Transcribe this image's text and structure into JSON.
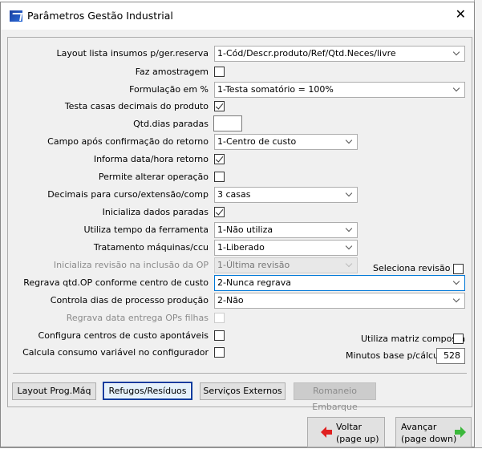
{
  "window": {
    "title": "Parâmetros Gestão Industrial"
  },
  "fields": [
    {
      "name": "layout-lista-insumos",
      "label": "Layout lista insumos p/ger.reserva",
      "type": "combo",
      "value": "1-Cód/Descr.produto/Ref/Qtd.Neces/livre",
      "wide": true
    },
    {
      "name": "faz-amostragem",
      "label": "Faz amostragem",
      "type": "check",
      "checked": false
    },
    {
      "name": "formulacao",
      "label": "Formulação em %",
      "type": "combo",
      "value": "1-Testa somatório = 100%",
      "wide": true
    },
    {
      "name": "testa-casas-decimais",
      "label": "Testa casas decimais do produto",
      "type": "check",
      "checked": true
    },
    {
      "name": "qtd-dias-paradas",
      "label": "Qtd.dias paradas",
      "type": "text",
      "value": ""
    },
    {
      "name": "campo-apos-confirmacao",
      "label": "Campo após confirmação do retorno",
      "type": "combo",
      "value": "1-Centro de custo"
    },
    {
      "name": "informa-data-hora",
      "label": "Informa data/hora retorno",
      "type": "check",
      "checked": true
    },
    {
      "name": "permite-alterar-operacao",
      "label": "Permite alterar operação",
      "type": "check",
      "checked": false
    },
    {
      "name": "decimais-curso",
      "label": "Decimais para curso/extensão/comp",
      "type": "combo",
      "value": "3 casas"
    },
    {
      "name": "inicializa-dados-paradas",
      "label": "Inicializa dados paradas",
      "type": "check",
      "checked": true
    },
    {
      "name": "utiliza-tempo-ferramenta",
      "label": "Utiliza tempo da ferramenta",
      "type": "combo",
      "value": "1-Não utiliza"
    },
    {
      "name": "tratamento-maquinas",
      "label": "Tratamento máquinas/ccu",
      "type": "combo",
      "value": "1-Liberado"
    },
    {
      "name": "inicializa-revisao",
      "label": "Inicializa revisão na inclusão da OP",
      "type": "combo",
      "value": "1-Última revisão",
      "disabled": true
    },
    {
      "name": "regrava-qtd-op",
      "label": "Regrava qtd.OP conforme centro de custo",
      "type": "combo",
      "value": "2-Nunca regrava",
      "wide": true,
      "focus": true
    },
    {
      "name": "controla-dias-processo",
      "label": "Controla dias de processo produção",
      "type": "combo",
      "value": "2-Não",
      "wide": true
    },
    {
      "name": "regrava-data-entrega",
      "label": "Regrava data entrega OPs filhas",
      "type": "check",
      "checked": false,
      "disabled": true
    },
    {
      "name": "configura-centros-custo",
      "label": "Configura centros de custo apontáveis",
      "type": "check",
      "checked": false
    },
    {
      "name": "calcula-consumo-variavel",
      "label": "Calcula consumo variável no configurador",
      "type": "check",
      "checked": false
    }
  ],
  "right_fields": {
    "seleciona_revisao": {
      "label": "Seleciona revisão",
      "checked": false
    },
    "utiliza_matriz": {
      "label": "Utiliza matriz composta",
      "checked": false
    },
    "minutos_base": {
      "label": "Minutos base p/cálculo",
      "value": "528"
    }
  },
  "buttons": {
    "layout_prog": "Layout Prog.Máq",
    "refugos": "Refugos/Resíduos",
    "servicos": "Serviços Externos",
    "romaneio": "Romaneio Embarque",
    "voltar": [
      "Voltar",
      "(page up)"
    ],
    "avancar": [
      "Avançar",
      "(page down)"
    ]
  }
}
